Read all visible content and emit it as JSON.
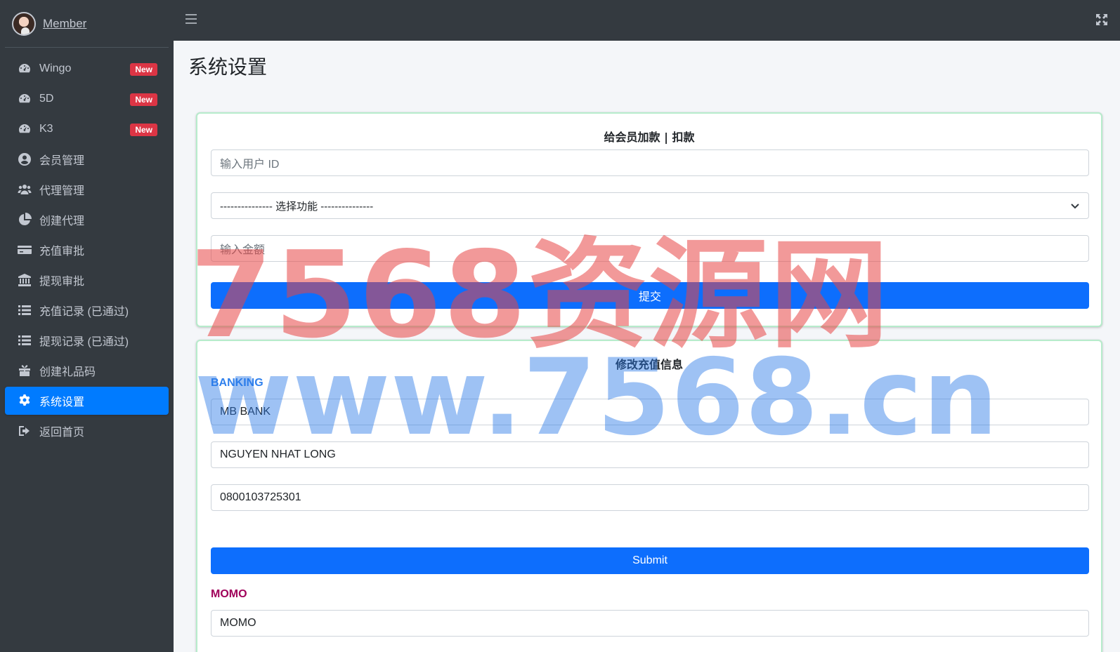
{
  "sidebar": {
    "user_name": "Member",
    "items": [
      {
        "label": "Wingo",
        "icon": "tachometer-icon",
        "badge": "New"
      },
      {
        "label": "5D",
        "icon": "tachometer-icon",
        "badge": "New"
      },
      {
        "label": "K3",
        "icon": "tachometer-icon",
        "badge": "New"
      },
      {
        "label": "会员管理",
        "icon": "user-circle-icon"
      },
      {
        "label": "代理管理",
        "icon": "users-icon"
      },
      {
        "label": "创建代理",
        "icon": "pie-chart-icon"
      },
      {
        "label": "充值审批",
        "icon": "credit-card-icon"
      },
      {
        "label": "提现审批",
        "icon": "bank-icon"
      },
      {
        "label": "充值记录 (已通过)",
        "icon": "list-icon"
      },
      {
        "label": "提现记录 (已通过)",
        "icon": "list-icon"
      },
      {
        "label": "创建礼品码",
        "icon": "gift-icon"
      },
      {
        "label": "系统设置",
        "icon": "gear-icon",
        "active": true
      },
      {
        "label": "返回首页",
        "icon": "sign-out-icon"
      }
    ]
  },
  "header": {
    "menu_icon": "hamburger-icon",
    "fullscreen_icon": "expand-icon"
  },
  "page": {
    "title": "系统设置"
  },
  "balance_card": {
    "title": "给会员加款 | 扣款",
    "user_id_placeholder": "输入用户 ID",
    "function_select": "--------------- 选择功能 ---------------",
    "amount_placeholder": "输入金额",
    "submit_label": "提交"
  },
  "recharge_card": {
    "title": "修改充值信息",
    "banking_label": "BANKING",
    "bank_name": "MB BANK",
    "account_name": "NGUYEN NHAT LONG",
    "account_number": "0800103725301",
    "submit_label": "Submit",
    "momo_label": "MOMO",
    "momo_value": "MOMO"
  },
  "watermark": {
    "line1": "7568资源网",
    "line2": "www.7568.cn"
  },
  "colors": {
    "sidebar_bg": "#343a40",
    "active_item": "#007bff",
    "badge": "#dc3545",
    "primary_button": "#0d6efd",
    "banking_label": "#2f80ed",
    "momo_label": "#a0005a"
  }
}
